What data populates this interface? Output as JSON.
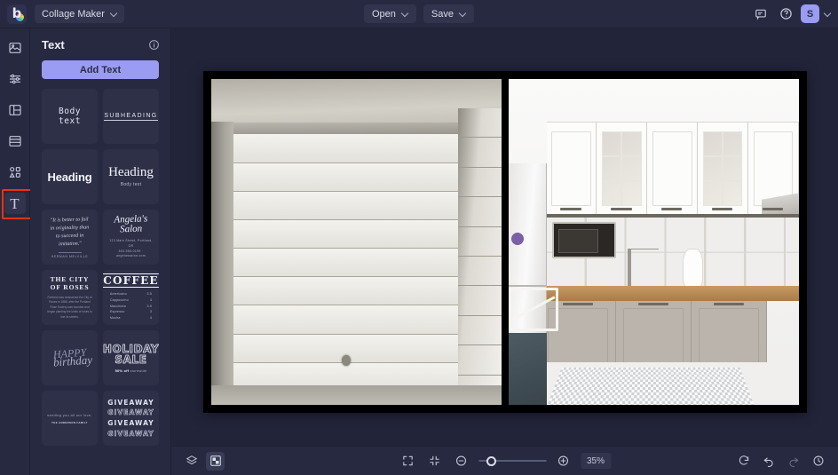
{
  "topbar": {
    "logo_letter": "b",
    "project_name": "Collage Maker",
    "open_label": "Open",
    "save_label": "Save",
    "avatar_initial": "S"
  },
  "rail": {
    "items": [
      {
        "name": "photos",
        "label": "Photos"
      },
      {
        "name": "adjust",
        "label": "Adjust"
      },
      {
        "name": "layout",
        "label": "Layout"
      },
      {
        "name": "templates",
        "label": "Templates"
      },
      {
        "name": "elements",
        "label": "Elements"
      },
      {
        "name": "text",
        "label": "Text",
        "glyph": "T",
        "active": true,
        "highlighted": true
      }
    ]
  },
  "panel": {
    "title": "Text",
    "add_text_label": "Add Text",
    "presets": [
      {
        "id": "body-text",
        "kind": "body",
        "text": "Body text"
      },
      {
        "id": "subheading",
        "kind": "subheading",
        "text": "SUBHEADING"
      },
      {
        "id": "heading-bold",
        "kind": "heading-bold",
        "text": "Heading"
      },
      {
        "id": "heading-serif",
        "kind": "heading-serif",
        "text": "Heading",
        "sub": "Body text"
      },
      {
        "id": "quote",
        "kind": "quote",
        "text": "\"It is better to fail in originality than to succeed in imitation.\"",
        "author": "HERMAN MELVILLE"
      },
      {
        "id": "salon",
        "kind": "salon",
        "text": "Angela's Salon",
        "lines": "123 Main Street, Portland, OR\n503.555.0199 · angelassalon.com"
      },
      {
        "id": "city-of-roses",
        "kind": "city",
        "title": "THE CITY\nOF ROSES",
        "body": "Portland was nicknamed the City of Roses in 1888, after the Portland Rose Society was founded and began planting the kinds of roses to line its streets."
      },
      {
        "id": "coffee-menu",
        "kind": "coffee",
        "title": "COFFEE",
        "items": [
          {
            "name": "Americano",
            "price": "3.5"
          },
          {
            "name": "Cappuccino",
            "price": "4"
          },
          {
            "name": "Macchiato",
            "price": "3.5"
          },
          {
            "name": "Espresso",
            "price": "3"
          },
          {
            "name": "Mocha",
            "price": "4"
          }
        ]
      },
      {
        "id": "happy-birthday",
        "kind": "birthday",
        "line1": "HAPPY",
        "line2": "birthday"
      },
      {
        "id": "holiday-sale",
        "kind": "holiday",
        "line1": "HOLIDAY",
        "line2": "SALE",
        "sub_bold": "50% off",
        "sub_rest": "storewide"
      },
      {
        "id": "sending-love",
        "kind": "love",
        "text": "sending you all our love,",
        "sub": "THE ANDERSON FAMILY"
      },
      {
        "id": "giveaway",
        "kind": "giveaway",
        "text": "GIVEAWAY",
        "repeat": 4
      }
    ]
  },
  "canvas": {
    "photos": [
      {
        "id": "photo-left",
        "alt": "Unfinished room with white aerated concrete block walls and concrete ceiling"
      },
      {
        "id": "photo-right",
        "alt": "Modern kitchen with white upper cabinets, grey lower cabinets and wood countertop"
      }
    ]
  },
  "bottombar": {
    "layers_label": "Layers",
    "grid_label": "Transparency grid",
    "fit_screen_label": "Fit to screen",
    "fit_content_label": "Fit to content",
    "zoom_out_label": "Zoom out",
    "zoom_in_label": "Zoom in",
    "zoom_value": "35%",
    "zoom_percent": 35,
    "reset_label": "Reset",
    "undo_label": "Undo",
    "redo_label": "Redo",
    "history_label": "History"
  },
  "colors": {
    "app_bg": "#22243a",
    "chrome": "#272940",
    "accent": "#9a9bf2",
    "card": "#2e3048",
    "highlight": "#f0330e",
    "text": "#e2e4f0"
  }
}
